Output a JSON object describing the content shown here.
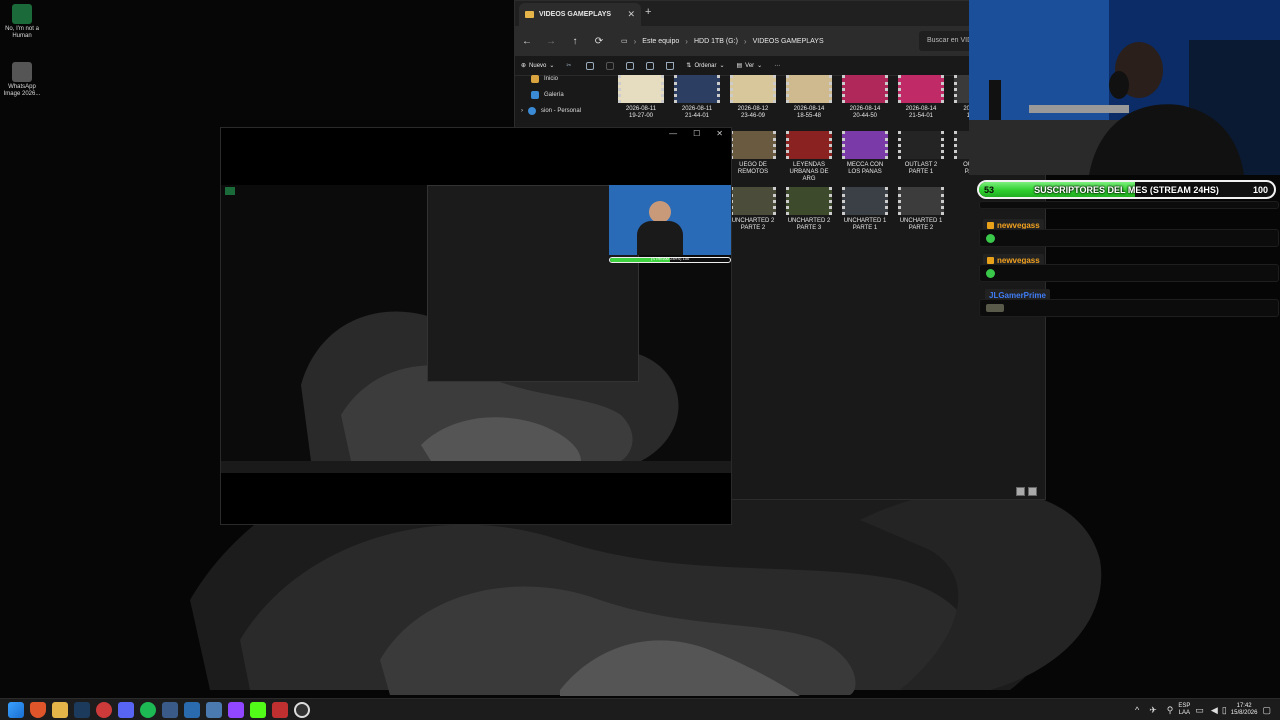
{
  "desktop": {
    "icons": [
      {
        "label_line1": "No, I'm not a",
        "label_line2": "Human"
      },
      {
        "label_line1": "WhatsApp",
        "label_line2": "Image 2026..."
      }
    ]
  },
  "explorer": {
    "tab_title": "VIDEOS GAMEPLAYS",
    "close_glyph": "✕",
    "new_tab_glyph": "+",
    "breadcrumbs": [
      "Este equipo",
      "HDD 1TB (G:)",
      "VIDEOS GAMEPLAYS"
    ],
    "search_placeholder": "Buscar en VIDEOS GAMEPLAYS",
    "commands": {
      "new": "Nuevo",
      "sort": "Ordenar",
      "view": "Ver",
      "more": "···"
    },
    "sidebar": [
      "Inicio",
      "Galería",
      "sion - Personal"
    ],
    "files": [
      {
        "name_line1": "2026-08-11",
        "name_line2": "19-27-00",
        "color": "#e6dcc0"
      },
      {
        "name_line1": "2026-08-11",
        "name_line2": "21-44-01",
        "color": "#2c3e62"
      },
      {
        "name_line1": "2026-08-12",
        "name_line2": "23-46-09",
        "color": "#d8c79a"
      },
      {
        "name_line1": "2026-08-14",
        "name_line2": "18-55-48",
        "color": "#cfb98f"
      },
      {
        "name_line1": "2026-08-14",
        "name_line2": "20-44-50",
        "color": "#b0285a"
      },
      {
        "name_line1": "2026-08-14",
        "name_line2": "21-54-01",
        "color": "#c02a66"
      },
      {
        "name_line1": "2026-08-1",
        "name_line2": "17-40-1",
        "color": "#3a3a3a"
      },
      {
        "name_line1": "UEGO DE",
        "name_line2": "REMOTOS",
        "color": "#6a5a40"
      },
      {
        "name_line1": "LEYENDAS",
        "name_line2": "URBANAS DE",
        "name_line3": "ARG",
        "color": "#8a2222"
      },
      {
        "name_line1": "MECCA CON",
        "name_line2": "LOS PANAS",
        "color": "#7a3aa8"
      },
      {
        "name_line1": "OUTLAST 2",
        "name_line2": "PARTE 1",
        "color": "#242424"
      },
      {
        "name_line1": "OUTLAST",
        "name_line2": "PARTE 2",
        "color": "#2a2a2a"
      },
      {
        "name_line1": "UNCHARTED 2",
        "name_line2": "PARTE 2",
        "color": "#4c4c3a"
      },
      {
        "name_line1": "UNCHARTED 2",
        "name_line2": "PARTE 3",
        "color": "#3e4a2c"
      },
      {
        "name_line1": "UNCHARTED 1",
        "name_line2": "PARTE 1",
        "color": "#3a4046"
      },
      {
        "name_line1": "UNCHARTED 1",
        "name_line2": "PARTE 2",
        "color": "#3c3c3c"
      }
    ]
  },
  "preview": {
    "controls": [
      "—",
      "☐",
      "✕"
    ],
    "sub_bar_text": "(STREAM 24HS)",
    "sub_bar_max": "100"
  },
  "overlay": {
    "sub_goal": {
      "current": "53",
      "label": "SUSCRIPTORES DEL MES (STREAM 24HS)",
      "max": "100",
      "progress": 0.53
    },
    "chat": [
      {
        "user": "newvegass",
        "user_color": "#f2a11f"
      },
      {
        "user": "newvegass",
        "user_color": "#f2a11f"
      },
      {
        "user": "JLGamerPrime",
        "user_color": "#3f7cf5"
      }
    ]
  },
  "taskbar": {
    "apps": [
      "start",
      "brave",
      "file-explorer",
      "steam",
      "chrome",
      "discord",
      "spotify",
      "screen",
      "app",
      "controller",
      "twitch",
      "kick",
      "media",
      "obs"
    ],
    "lang_line1": "ESP",
    "lang_line2": "LAA",
    "time": "17:42",
    "date": "15/8/2026",
    "tray_chevron": "^"
  }
}
